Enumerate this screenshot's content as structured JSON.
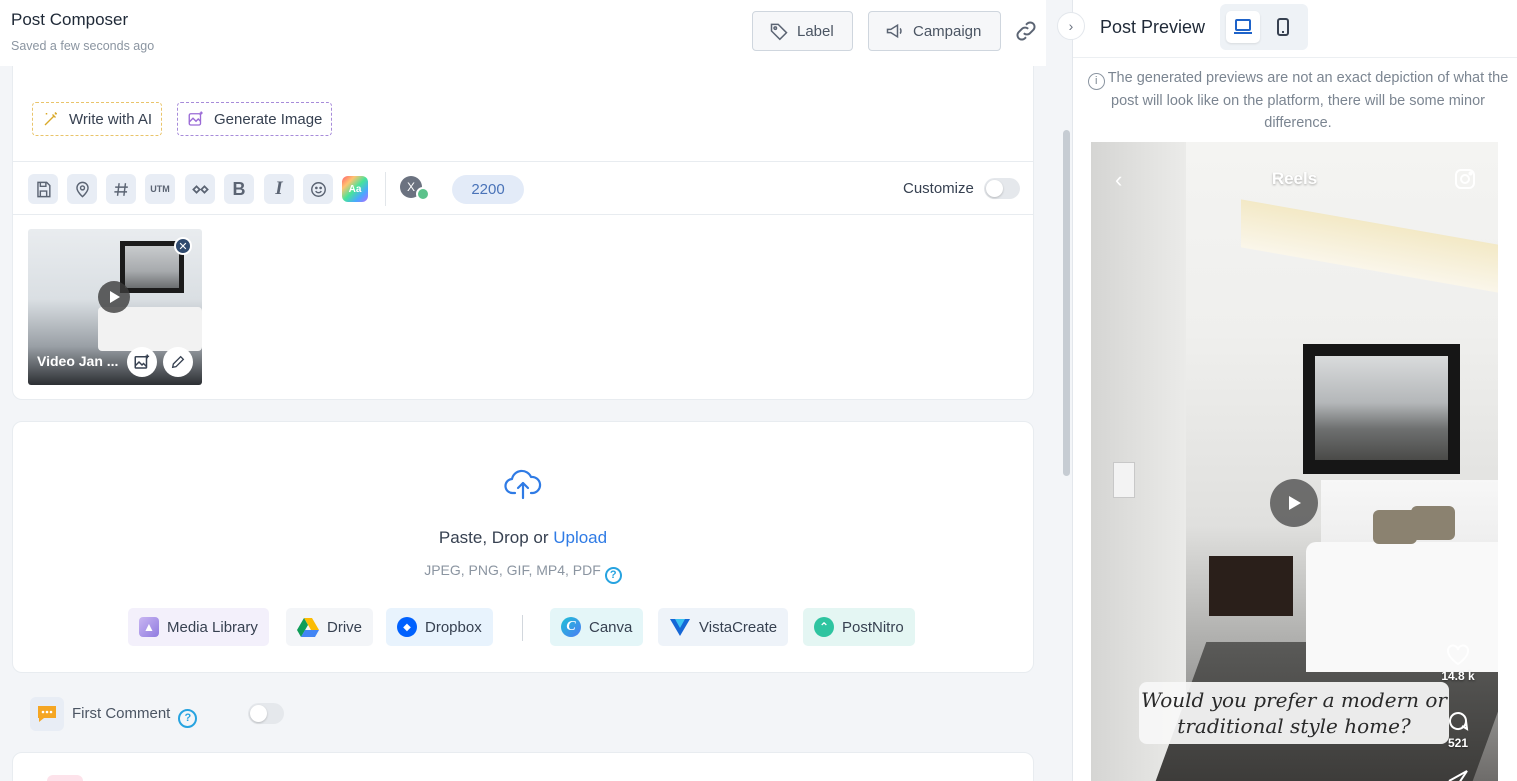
{
  "header": {
    "title": "Post Composer",
    "subtitle": "Saved a few seconds ago",
    "label_button": "Label",
    "campaign_button": "Campaign"
  },
  "composer": {
    "write_ai": "Write with AI",
    "generate_image": "Generate Image",
    "toolbar": {
      "utm": "UTM",
      "bold": "B",
      "italic": "I",
      "text_style": "Aa",
      "account_initial": "X",
      "char_count": "2200",
      "customize_label": "Customize",
      "customize_on": false
    },
    "media": {
      "name": "Video Jan ..."
    }
  },
  "upload": {
    "prefix": "Paste, Drop or ",
    "link": "Upload",
    "types": "JPEG, PNG, GIF, MP4, PDF",
    "sources": [
      "Media Library",
      "Drive",
      "Dropbox",
      "Canva",
      "VistaCreate",
      "PostNitro"
    ]
  },
  "first_comment": {
    "label": "First Comment",
    "enabled": false
  },
  "preview": {
    "title": "Post Preview",
    "note": "The generated previews are not an exact depiction of what the post will look like on the platform, there will be some minor difference.",
    "reels_title": "Reels",
    "likes": "14.8 k",
    "comments": "521",
    "caption": "Would you prefer a modern or traditional style home?"
  },
  "icons": {
    "accent": "#2f7be5",
    "help": "#27a3e0"
  }
}
